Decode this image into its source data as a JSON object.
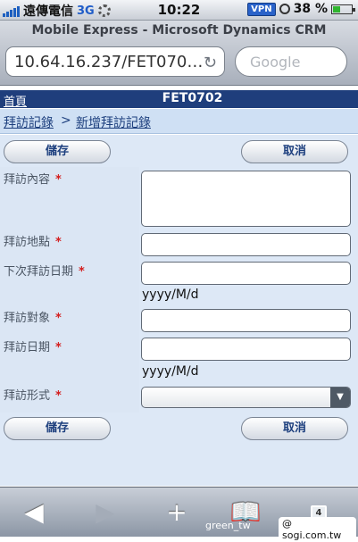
{
  "status_bar": {
    "carrier": "遠傳電信",
    "network": "3G",
    "time": "10:22",
    "vpn": "VPN",
    "battery": "38 %",
    "icons": [
      "signal-bars-icon",
      "activity-spinner-icon",
      "vpn-icon",
      "rotation-lock-icon",
      "battery-icon"
    ]
  },
  "browser": {
    "title": "Mobile Express - Microsoft Dynamics CRM",
    "url": "10.64.16.237/FET070…",
    "search_placeholder": "Google",
    "reload_icon": "reload-icon"
  },
  "crm": {
    "home_link": "首頁",
    "record_id": "FET0702",
    "breadcrumb": {
      "parent": "拜訪記錄",
      "separator": ">",
      "current": "新增拜訪記錄"
    },
    "buttons": {
      "save": "儲存",
      "cancel": "取消"
    },
    "fields": [
      {
        "label": "拜訪內容",
        "required": "*"
      },
      {
        "label": "拜訪地點",
        "required": "*"
      },
      {
        "label": "下次拜訪日期",
        "required": "*",
        "hint": "yyyy/M/d"
      },
      {
        "label": "拜訪對象",
        "required": "*"
      },
      {
        "label": "拜訪日期",
        "required": "*",
        "hint": "yyyy/M/d"
      },
      {
        "label": "拜訪形式",
        "required": "*"
      }
    ]
  },
  "toolbar": {
    "icons": [
      "back-icon",
      "forward-icon",
      "add-bookmark-icon",
      "bookmarks-icon",
      "pages-icon"
    ],
    "pages_count": "4"
  },
  "watermark": {
    "user": "green_tw",
    "site": "@ sogi.com.tw"
  },
  "colors": {
    "header_bg": "#1f3e7c",
    "breadcrumb_bg": "#cfe0f4",
    "required_star": "#d41d1d"
  }
}
